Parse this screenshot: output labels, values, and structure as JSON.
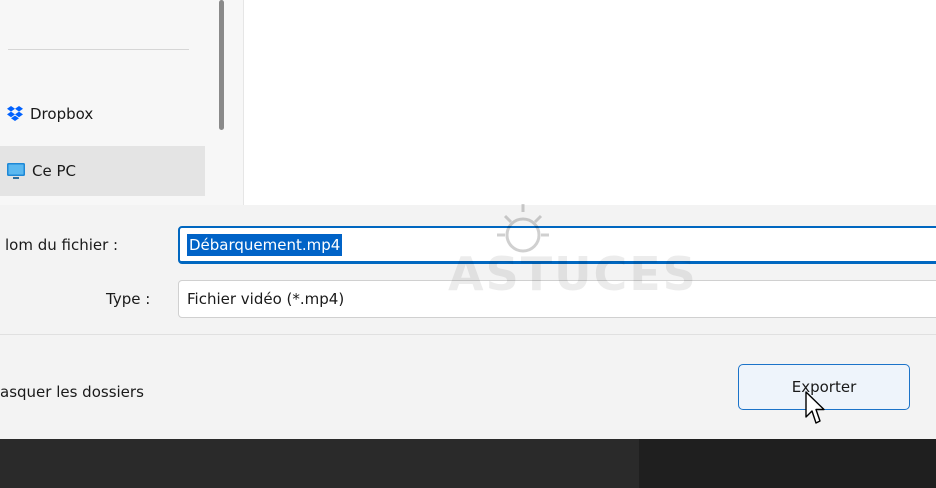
{
  "navigation": {
    "items": [
      {
        "label": "Dropbox",
        "icon": "dropbox-icon",
        "selected": false
      },
      {
        "label": "Ce PC",
        "icon": "computer-icon",
        "selected": true
      }
    ]
  },
  "form": {
    "filename_label": "lom du fichier :",
    "filename_value": "Débarquement.mp4",
    "type_label": "Type :",
    "type_value": "Fichier vidéo (*.mp4)"
  },
  "footer": {
    "hide_folders_label": "asquer les dossiers",
    "export_label": "Exporter"
  },
  "watermark": {
    "text": "ASTUCES"
  },
  "colors": {
    "accent": "#0067c0",
    "selection": "#0063c7",
    "dropbox": "#0061ff",
    "taskbar": "#2a2a2a"
  }
}
